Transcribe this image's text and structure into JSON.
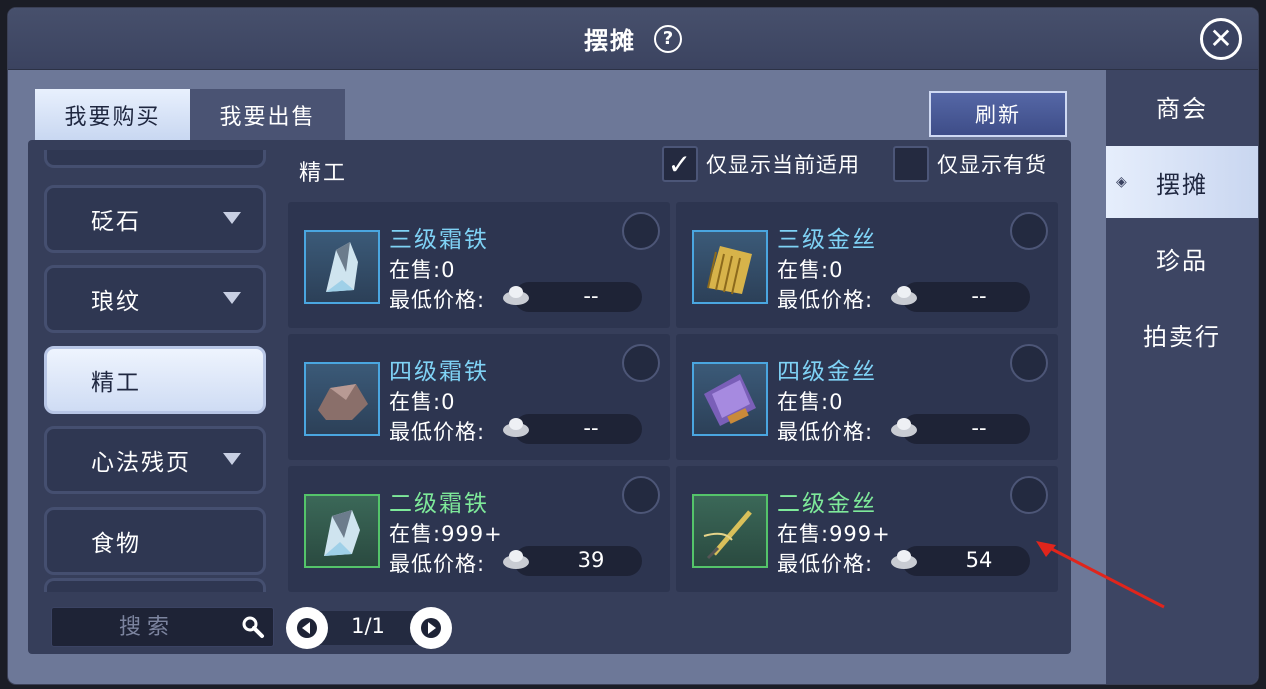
{
  "window": {
    "title": "摆摊",
    "help": "?",
    "close": "✕"
  },
  "right_nav": [
    {
      "label": "商会",
      "active": false
    },
    {
      "label": "摆摊",
      "active": true
    },
    {
      "label": "珍品",
      "active": false
    },
    {
      "label": "拍卖行",
      "active": false
    }
  ],
  "tabs": {
    "buy": "我要购买",
    "sell": "我要出售"
  },
  "refresh_label": "刷新",
  "categories": [
    {
      "label": "砭石",
      "has_arrow": true
    },
    {
      "label": "琅纹",
      "has_arrow": true
    },
    {
      "label": "精工",
      "has_arrow": false,
      "active": true
    },
    {
      "label": "心法残页",
      "has_arrow": true
    },
    {
      "label": "食物",
      "has_arrow": false
    }
  ],
  "section_title": "精工",
  "filters": {
    "current_only": {
      "label": "仅显示当前适用",
      "checked": true
    },
    "in_stock": {
      "label": "仅显示有货",
      "checked": false
    }
  },
  "items": [
    {
      "name": "三级霜铁",
      "on_sale": "在售:0",
      "price_label": "最低价格:",
      "price": "--",
      "rarity": "blue",
      "icon": "frost-iron-icon"
    },
    {
      "name": "三级金丝",
      "on_sale": "在售:0",
      "price_label": "最低价格:",
      "price": "--",
      "rarity": "blue",
      "icon": "gold-silk-icon"
    },
    {
      "name": "四级霜铁",
      "on_sale": "在售:0",
      "price_label": "最低价格:",
      "price": "--",
      "rarity": "blue",
      "icon": "ore-icon"
    },
    {
      "name": "四级金丝",
      "on_sale": "在售:0",
      "price_label": "最低价格:",
      "price": "--",
      "rarity": "blue",
      "icon": "purple-scroll-icon"
    },
    {
      "name": "二级霜铁",
      "on_sale": "在售:999+",
      "price_label": "最低价格:",
      "price": "39",
      "rarity": "green",
      "icon": "frost-iron-icon"
    },
    {
      "name": "二级金丝",
      "on_sale": "在售:999+",
      "price_label": "最低价格:",
      "price": "54",
      "rarity": "green",
      "icon": "needle-thread-icon"
    }
  ],
  "search": {
    "placeholder": "搜索"
  },
  "pager": {
    "indicator": "1/1"
  }
}
